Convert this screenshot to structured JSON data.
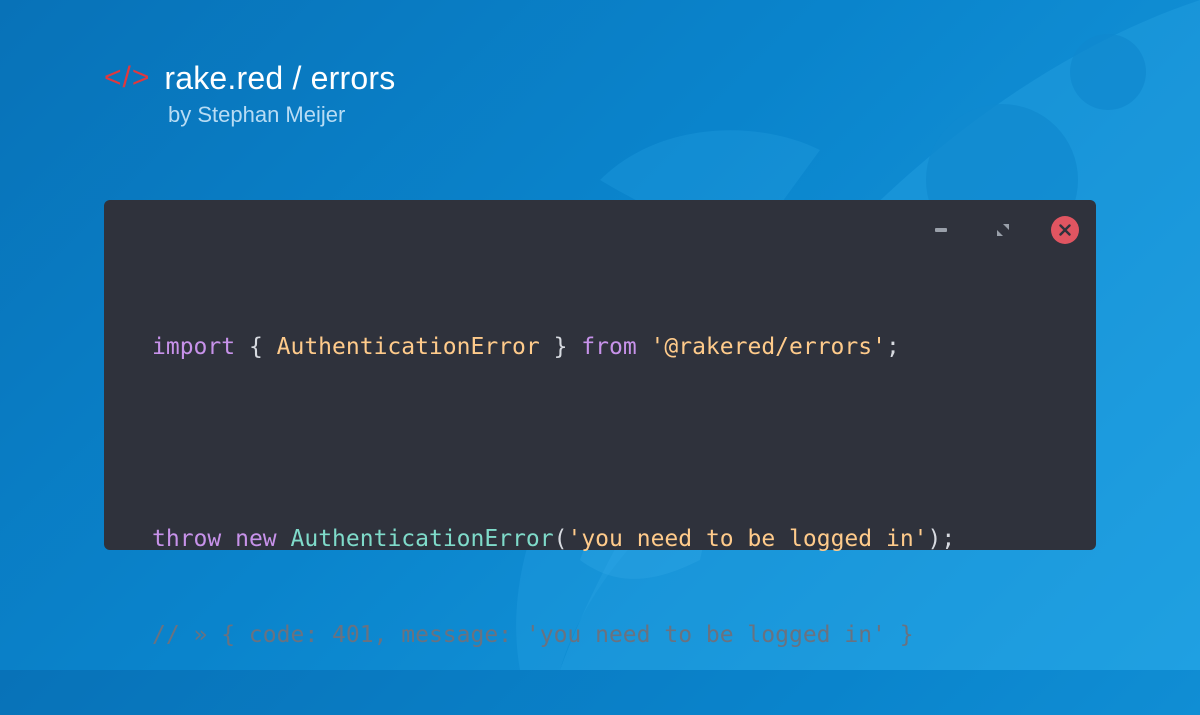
{
  "colors": {
    "logo": "#e0383e",
    "window_bg": "#2f323c",
    "keyword": "#c792ea",
    "class_name": "#ffcb8b",
    "constructor": "#7fdbca",
    "string": "#ffcb8b",
    "comment": "#6a7280",
    "close_button": "#e05561"
  },
  "brand": {
    "logo_text": "</>",
    "title": "rake.red / errors",
    "subtitle": "by Stephan Meijer"
  },
  "window": {
    "controls": {
      "minimize_icon": "minimize-icon",
      "resize_icon": "resize-icon",
      "close_icon": "close-icon"
    },
    "code": {
      "line1": {
        "kw_import": "import",
        "brace_open": " { ",
        "class_name": "AuthenticationError",
        "brace_close": " } ",
        "kw_from": "from",
        "space": " ",
        "module": "'@rakered/errors'",
        "semi": ";"
      },
      "line3": {
        "kw_throw": "throw",
        "sp1": " ",
        "kw_new": "new",
        "sp2": " ",
        "ctor": "AuthenticationError",
        "paren_open": "(",
        "message": "'you need to be logged in'",
        "paren_close": ");"
      },
      "line4": {
        "comment": "// » { code: 401, message: 'you need to be logged in' }"
      }
    }
  }
}
